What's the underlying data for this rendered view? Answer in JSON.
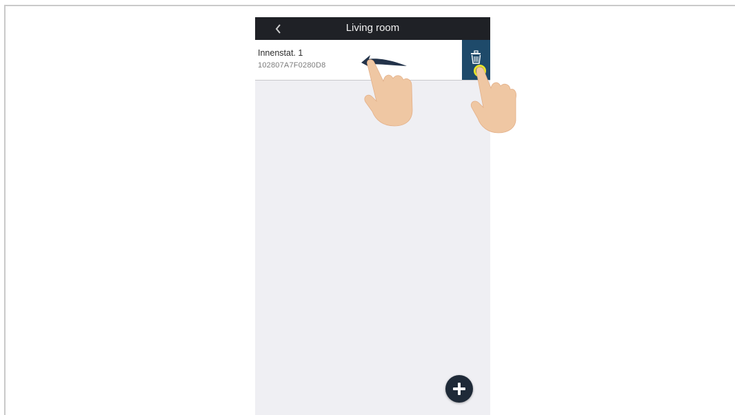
{
  "header": {
    "title": "Living room",
    "back_icon": "chevron-left-icon"
  },
  "device": {
    "name": "Innenstat. 1",
    "serial": "102807A7F0280D8"
  },
  "delete_action": {
    "icon": "trash-icon",
    "color": "#1e4a6a"
  },
  "add_button": {
    "icon": "plus-icon",
    "color": "#1f2a38"
  },
  "gesture": {
    "swipe_direction": "left",
    "icons": [
      "swipe-arrow-icon",
      "hand-pointer-icon",
      "tap-highlight-icon"
    ]
  }
}
